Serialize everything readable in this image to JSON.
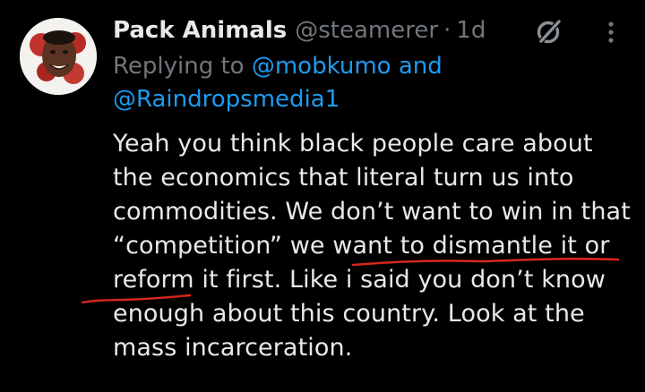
{
  "tweet": {
    "author": {
      "display_name": "Pack Animals",
      "handle": "@steamerer",
      "separator": "·",
      "timestamp": "1d"
    },
    "reply": {
      "prefix": "Replying to",
      "mention_1": "@mobkumo",
      "conjunction": "and",
      "mention_2": "@Raindropsmedia1"
    },
    "body": "Yeah you think black people care about the economics that literal turn us into commodities. We don’t want to win in that “competition” we want to dismantle it or reform it first. Like i said you don’t know enough about this country. Look at the mass incarceration.",
    "icons": {
      "grok": "grok-icon",
      "more": "more-options-icon",
      "avatar": "profile-avatar"
    },
    "colors": {
      "background": "#000000",
      "text": "#e7e9ea",
      "secondary": "#71767b",
      "link": "#1d9bf0",
      "annotation": "#d7261e"
    }
  }
}
